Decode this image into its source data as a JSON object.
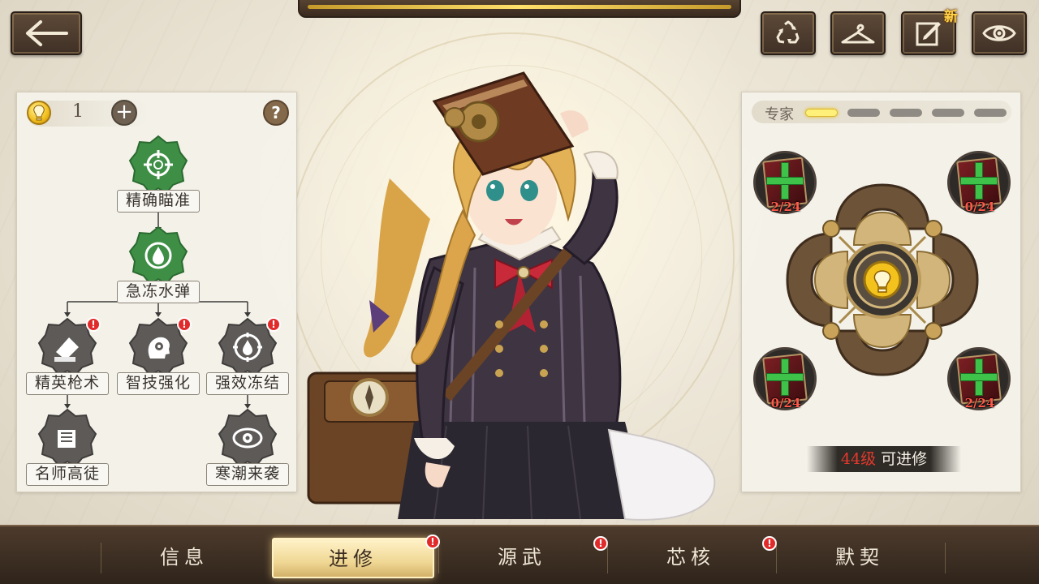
{
  "top_bar": {
    "new_badge": "新",
    "buttons": [
      {
        "name": "recycle-icon"
      },
      {
        "name": "hanger-icon"
      },
      {
        "name": "edit-note-icon"
      },
      {
        "name": "eye-icon"
      }
    ]
  },
  "left_panel": {
    "points": "1",
    "help": "?",
    "plus": "+",
    "skills": [
      {
        "label": "精确瞄准",
        "state": "unlocked",
        "alert": false,
        "icon": "crosshair-icon"
      },
      {
        "label": "急冻水弹",
        "state": "unlocked",
        "alert": false,
        "icon": "water-drop-icon"
      },
      {
        "label": "精英枪术",
        "state": "locked",
        "alert": true,
        "icon": "ammo-icon"
      },
      {
        "label": "智技强化",
        "state": "locked",
        "alert": true,
        "icon": "brain-gear-icon"
      },
      {
        "label": "强效冻结",
        "state": "locked",
        "alert": true,
        "icon": "frost-drop-icon"
      },
      {
        "label": "名师高徒",
        "state": "locked",
        "alert": false,
        "icon": "book-hand-icon"
      },
      {
        "label": "寒潮来袭",
        "state": "locked",
        "alert": false,
        "icon": "frost-eye-icon"
      }
    ],
    "alert_mark": "!"
  },
  "right_panel": {
    "rank_label": "专家",
    "rank_active": 1,
    "rank_total": 5,
    "slots": [
      {
        "count": "2/24"
      },
      {
        "count": "0/24"
      },
      {
        "count": "0/24"
      },
      {
        "count": "2/24"
      }
    ],
    "level_num": "44级",
    "level_text": "可进修"
  },
  "bottom_nav": {
    "tabs": [
      {
        "label": "信息",
        "active": false,
        "alert": false
      },
      {
        "label": "进修",
        "active": true,
        "alert": true
      },
      {
        "label": "源武",
        "active": false,
        "alert": true
      },
      {
        "label": "芯核",
        "active": false,
        "alert": true
      },
      {
        "label": "默契",
        "active": false,
        "alert": false
      }
    ],
    "alert_mark": "!"
  },
  "colors": {
    "accent_gold": "#f0d895",
    "unlocked_green": "#3e8f45",
    "locked_gray": "#5d5a58",
    "alert_red": "#e12a2a",
    "level_red": "#e3392d"
  }
}
